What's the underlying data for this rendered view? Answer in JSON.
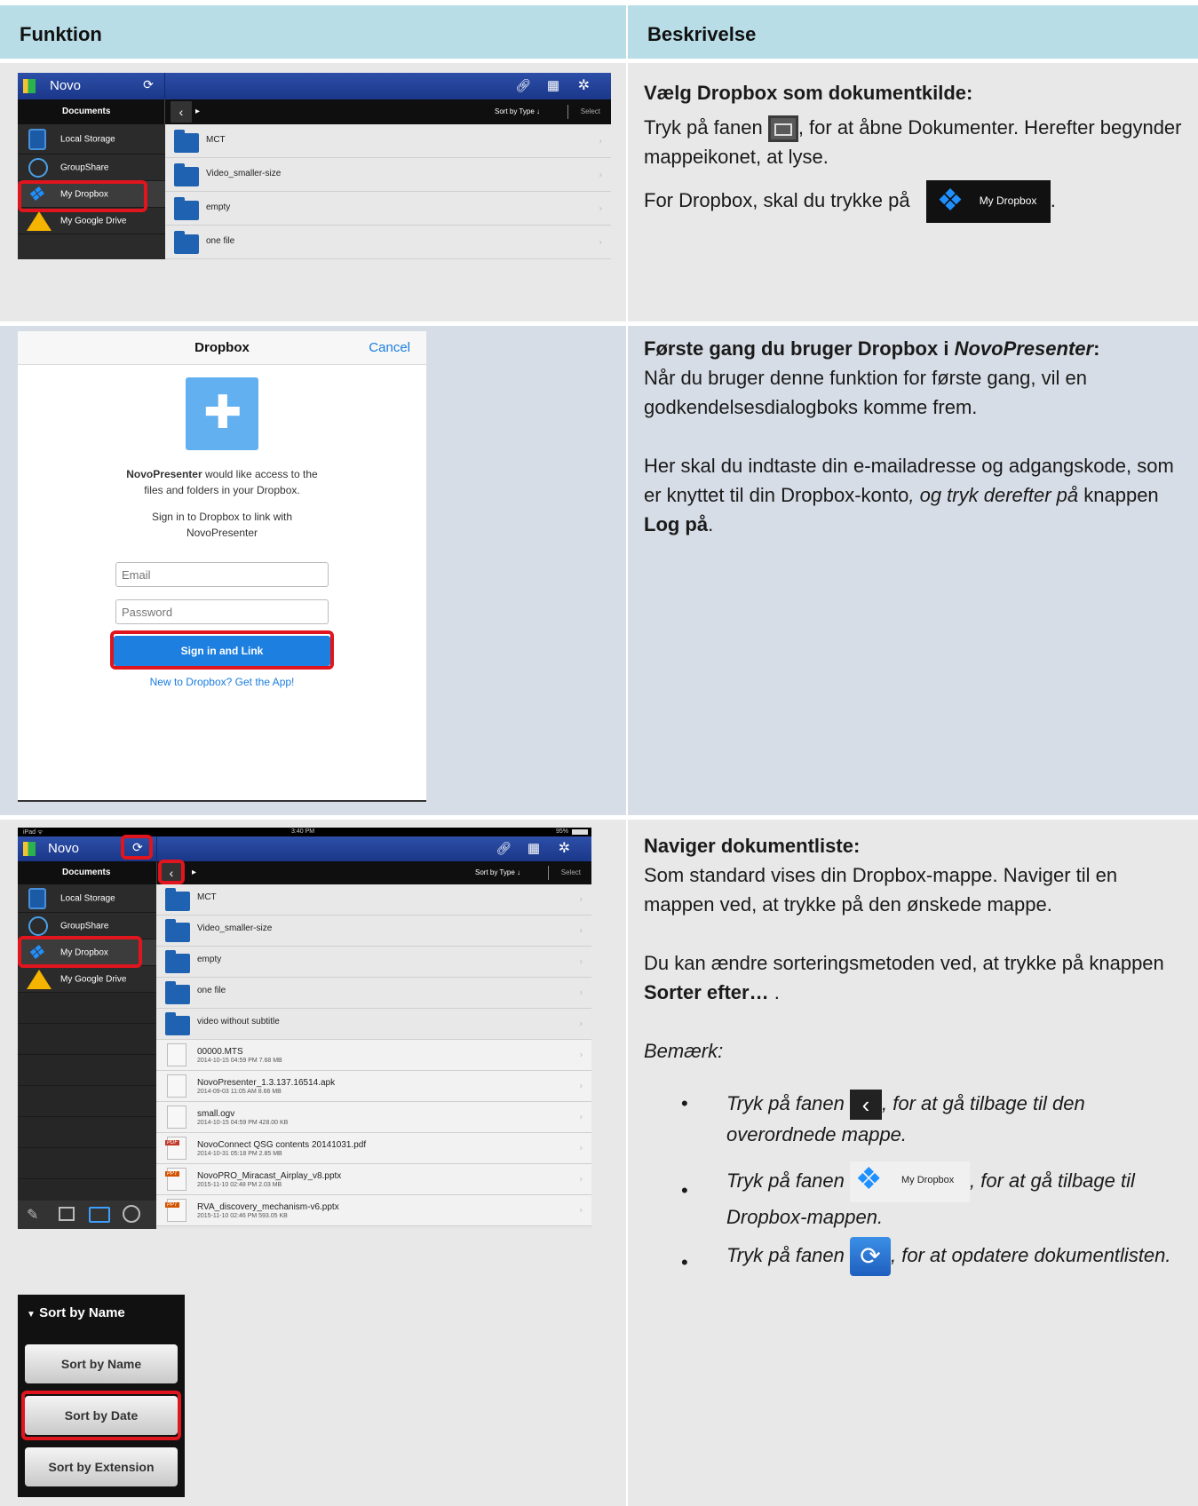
{
  "header": {
    "col1": "Funktion",
    "col2": "Beskrivelse"
  },
  "row1": {
    "title": "Vælg Dropbox som dokumentkilde:",
    "p1a": "Tryk på fanen ",
    "p1b": ", for at åbne Dokumenter. Herefter begynder mappeikonet, at lyse.",
    "p2a": "For Dropbox, skal du trykke på ",
    "p2b": ".",
    "inline_dropbox_label": "My Dropbox"
  },
  "row2": {
    "title_a": "Første gang du bruger Dropbox i ",
    "title_b": "NovoPresenter",
    "title_c": ":",
    "p1": "Når du bruger denne funktion for første gang, vil en godkendelsesdialogboks komme frem.",
    "p2a": "Her skal du indtaste din e-mailadresse og adgangskode, som er knyttet til din Dropbox-konto",
    "p2b": ", og tryk derefter på",
    "p2c": " knappen ",
    "p2d": "Log på",
    "p2e": "."
  },
  "row3": {
    "title": "Naviger dokumentliste:",
    "p1": "Som standard vises din Dropbox-mappe. Naviger til en mappen ved, at trykke på den ønskede mappe.",
    "p2a": "Du kan ændre sorteringsmetoden ved, at trykke på knappen ",
    "p2b": "Sorter efter…",
    "p2c": " .",
    "note": "Bemærk:",
    "b1a": "Tryk på fanen ",
    "b1b": ", for at gå tilbage til den overordnede mappe.",
    "b2a": "Tryk på fanen ",
    "b2b": ", for at gå tilbage til Dropbox-mappen.",
    "b3a": "Tryk på fanen ",
    "b3b": ", for at opdatere dokumentlisten.",
    "inline_dropbox_label": "My Dropbox"
  },
  "app1": {
    "logo": "Novo",
    "documents": "Documents",
    "sort": "Sort by Type ↓",
    "select": "Select",
    "side": [
      "Local Storage",
      "GroupShare",
      "My Dropbox",
      "My Google Drive"
    ],
    "folders": [
      "MCT",
      "Video_smaller-size",
      "empty",
      "one file"
    ]
  },
  "dropbox_dialog": {
    "title": "Dropbox",
    "cancel": "Cancel",
    "msg1_bold": "NovoPresenter",
    "msg1_rest": " would like access to the",
    "msg1_line2": "files and folders in your Dropbox.",
    "msg2_line1": "Sign in to Dropbox to link with",
    "msg2_line2": "NovoPresenter",
    "email_placeholder": "Email",
    "password_placeholder": "Password",
    "signin": "Sign in and Link",
    "get_app": "New to Dropbox? Get the App!"
  },
  "app2": {
    "status_left": "iPad ᯤ",
    "status_time": "3:40 PM",
    "status_batt": "95%",
    "logo": "Novo",
    "documents": "Documents",
    "sort": "Sort by Type ↓",
    "select": "Select",
    "side": [
      "Local Storage",
      "GroupShare",
      "My Dropbox",
      "My Google Drive"
    ],
    "folders": [
      "MCT",
      "Video_smaller-size",
      "empty",
      "one file",
      "video without subtitle"
    ],
    "files": [
      {
        "name": "00000.MTS",
        "meta": "2014-10-15 04:59 PM  7.68 MB",
        "tag": ""
      },
      {
        "name": "NovoPresenter_1.3.137.16514.apk",
        "meta": "2014-09-03 11:05 AM  8.66 MB",
        "tag": ""
      },
      {
        "name": "small.ogv",
        "meta": "2014-10-15 04:59 PM  428.00 KB",
        "tag": ""
      },
      {
        "name": "NovoConnect QSG contents 20141031.pdf",
        "meta": "2014-10-31 05:18 PM  2.85 MB",
        "tag": "PDF"
      },
      {
        "name": "NovoPRO_Miracast_Airplay_v8.pptx",
        "meta": "2015-11-10 02:48 PM  2.03 MB",
        "tag": "PPT"
      },
      {
        "name": "RVA_discovery_mechanism-v6.pptx",
        "meta": "2015-11-10 02:46 PM  593.05 KB",
        "tag": "PPT"
      }
    ]
  },
  "sortmenu": {
    "header": "Sort by Name",
    "opts": [
      "Sort by Name",
      "Sort by Date",
      "Sort by Extension"
    ]
  }
}
